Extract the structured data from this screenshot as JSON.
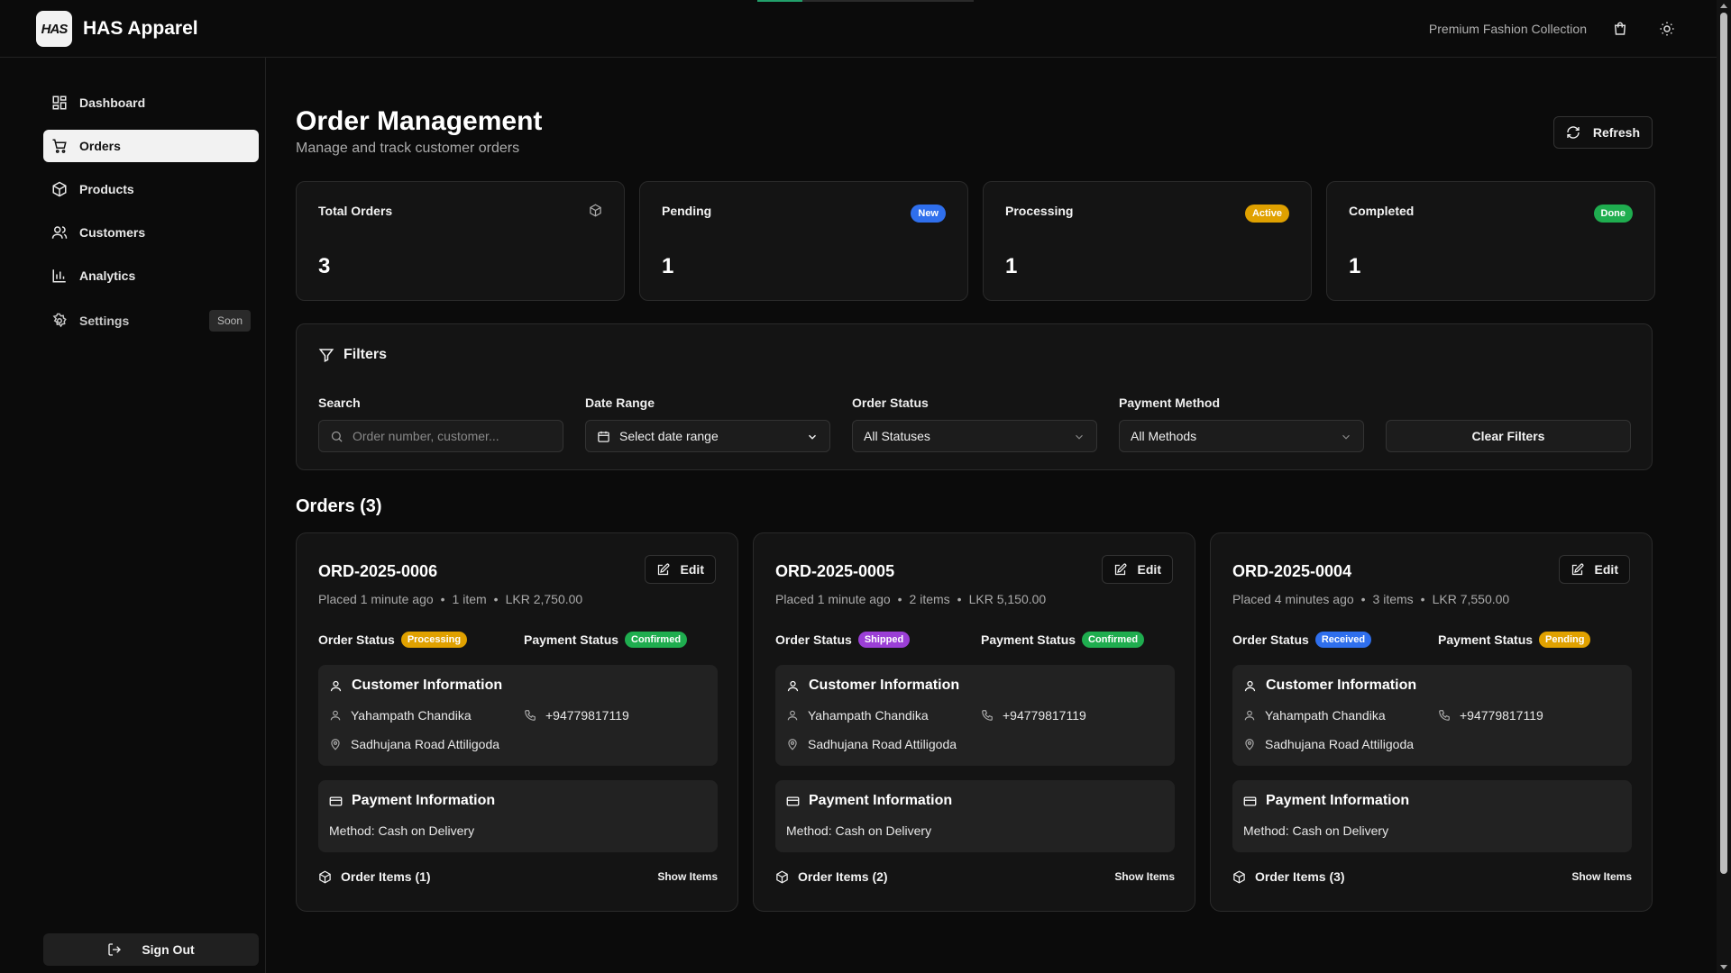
{
  "app": {
    "name": "HAS Apparel",
    "logo_text": "HAS",
    "tagline": "Premium Fashion Collection"
  },
  "header": {
    "cart_icon": "shopping-bag-icon",
    "theme_icon": "sun-icon"
  },
  "sidebar": {
    "items": [
      {
        "label": "Dashboard",
        "icon": "dashboard-icon"
      },
      {
        "label": "Orders",
        "icon": "cart-icon",
        "active": true
      },
      {
        "label": "Products",
        "icon": "box-icon"
      },
      {
        "label": "Customers",
        "icon": "users-icon"
      },
      {
        "label": "Analytics",
        "icon": "bar-chart-icon"
      },
      {
        "label": "Settings",
        "icon": "gear-icon",
        "badge": "Soon"
      }
    ],
    "signout_label": "Sign Out"
  },
  "page": {
    "title": "Order Management",
    "subtitle": "Manage and track customer orders",
    "refresh_label": "Refresh"
  },
  "stats": [
    {
      "label": "Total Orders",
      "value": "3",
      "icon": "box-icon"
    },
    {
      "label": "Pending",
      "value": "1",
      "badge": "New",
      "badge_color": "#2f6fed"
    },
    {
      "label": "Processing",
      "value": "1",
      "badge": "Active",
      "badge_color": "#e0a100"
    },
    {
      "label": "Completed",
      "value": "1",
      "badge": "Done",
      "badge_color": "#1fad4f"
    }
  ],
  "filters": {
    "title": "Filters",
    "search": {
      "label": "Search",
      "placeholder": "Order number, customer..."
    },
    "date": {
      "label": "Date Range",
      "value": "Select date range"
    },
    "status": {
      "label": "Order Status",
      "value": "All Statuses"
    },
    "payment": {
      "label": "Payment Method",
      "value": "All Methods"
    },
    "clear_label": "Clear Filters"
  },
  "orders": {
    "heading": "Orders (3)",
    "list": [
      {
        "number": "ORD-2025-0006",
        "placed": "Placed 1 minute ago",
        "count": "1 item",
        "total": "LKR 2,750.00",
        "order_status_label": "Order Status",
        "order_status": "Processing",
        "order_status_color": "#e0a100",
        "payment_status_label": "Payment Status",
        "payment_status": "Confirmed",
        "payment_status_color": "#1fad4f",
        "customer_title": "Customer Information",
        "customer_name": "Yahampath Chandika",
        "phone": "+94779817119",
        "address": "Sadhujana Road Attiligoda",
        "payment_title": "Payment Information",
        "method": "Method: Cash on Delivery",
        "items_label": "Order Items (1)",
        "show_items": "Show Items",
        "edit_label": "Edit"
      },
      {
        "number": "ORD-2025-0005",
        "placed": "Placed 1 minute ago",
        "count": "2 items",
        "total": "LKR 5,150.00",
        "order_status_label": "Order Status",
        "order_status": "Shipped",
        "order_status_color": "#9b3fd6",
        "payment_status_label": "Payment Status",
        "payment_status": "Confirmed",
        "payment_status_color": "#1fad4f",
        "customer_title": "Customer Information",
        "customer_name": "Yahampath Chandika",
        "phone": "+94779817119",
        "address": "Sadhujana Road Attiligoda",
        "payment_title": "Payment Information",
        "method": "Method: Cash on Delivery",
        "items_label": "Order Items (2)",
        "show_items": "Show Items",
        "edit_label": "Edit"
      },
      {
        "number": "ORD-2025-0004",
        "placed": "Placed 4 minutes ago",
        "count": "3 items",
        "total": "LKR 7,550.00",
        "order_status_label": "Order Status",
        "order_status": "Received",
        "order_status_color": "#2f6fed",
        "payment_status_label": "Payment Status",
        "payment_status": "Pending",
        "payment_status_color": "#e0a100",
        "customer_title": "Customer Information",
        "customer_name": "Yahampath Chandika",
        "phone": "+94779817119",
        "address": "Sadhujana Road Attiligoda",
        "payment_title": "Payment Information",
        "method": "Method: Cash on Delivery",
        "items_label": "Order Items (3)",
        "show_items": "Show Items",
        "edit_label": "Edit"
      }
    ]
  }
}
